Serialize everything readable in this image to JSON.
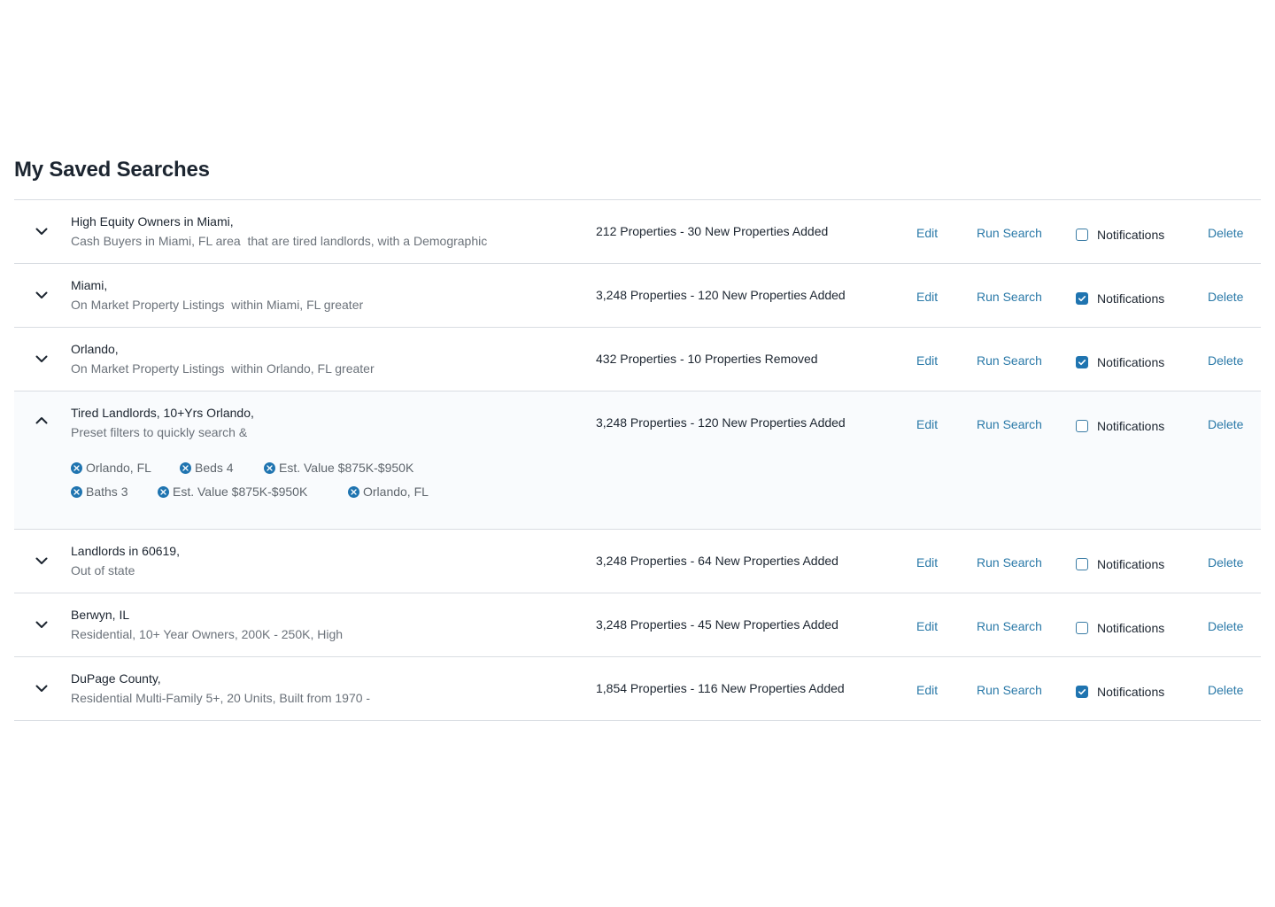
{
  "page": {
    "title": "My Saved Searches"
  },
  "labels": {
    "edit": "Edit",
    "run_search": "Run Search",
    "notifications": "Notifications",
    "delete": "Delete"
  },
  "colors": {
    "accent": "#2a79a8",
    "checkbox_checked": "#1f74b0",
    "expanded_row_bg": "#f9fbfd"
  },
  "searches": [
    {
      "name": "High Equity Owners in Miami,",
      "description": "Cash Buyers in Miami, FL area  that are tired landlords, with a Demographic",
      "summary": "212 Properties - 30 New Properties Added",
      "notifications": false,
      "expanded": false
    },
    {
      "name": "Miami,",
      "description": "On Market Property Listings  within Miami, FL greater",
      "summary": "3,248 Properties - 120 New Properties Added",
      "notifications": true,
      "expanded": false
    },
    {
      "name": "Orlando,",
      "description": "On Market Property Listings  within Orlando, FL greater",
      "summary": "432 Properties - 10 Properties Removed",
      "notifications": true,
      "expanded": false
    },
    {
      "name": "Tired Landlords, 10+Yrs Orlando,",
      "description": "Preset filters to quickly search &",
      "summary": "3,248 Properties - 120 New Properties Added",
      "notifications": false,
      "expanded": true,
      "filters": [
        "Orlando, FL",
        "Beds 4",
        "Est. Value $875K-$950K",
        "Baths 3",
        "Est. Value $875K-$950K",
        "Orlando, FL"
      ]
    },
    {
      "name": "Landlords in 60619,",
      "description": "Out of state",
      "summary": "3,248 Properties - 64 New Properties Added",
      "notifications": false,
      "expanded": false
    },
    {
      "name": "Berwyn, IL",
      "description": "Residential, 10+ Year Owners, 200K - 250K, High",
      "summary": "3,248 Properties - 45 New Properties Added",
      "notifications": false,
      "expanded": false
    },
    {
      "name": "DuPage County,",
      "description": "Residential Multi-Family 5+, 20 Units, Built from 1970 -",
      "summary": "1,854 Properties - 116 New Properties Added",
      "notifications": true,
      "expanded": false
    }
  ]
}
